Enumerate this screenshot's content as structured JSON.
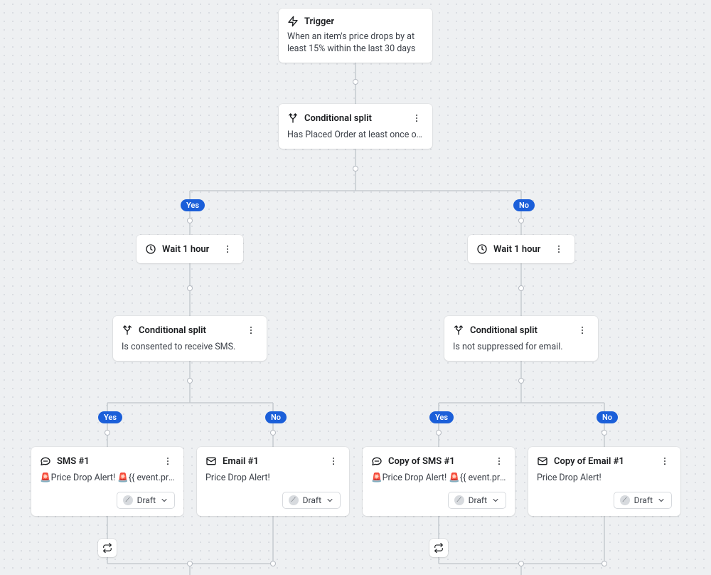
{
  "trigger": {
    "title": "Trigger",
    "body": "When an item's price drops by at least 15% within the last 30 days"
  },
  "split_top": {
    "title": "Conditional split",
    "body": "Has Placed Order at least once over all ti…"
  },
  "labels": {
    "yes": "Yes",
    "no": "No"
  },
  "wait_left": {
    "title": "Wait 1 hour"
  },
  "wait_right": {
    "title": "Wait 1 hour"
  },
  "split_left": {
    "title": "Conditional split",
    "body": "Is consented to receive SMS."
  },
  "split_right": {
    "title": "Conditional split",
    "body": "Is not suppressed for email."
  },
  "action_sms1": {
    "title": "SMS #1",
    "body": "🚨Price Drop Alert! 🚨{{ event.product_n…",
    "status": "Draft"
  },
  "action_email1": {
    "title": "Email #1",
    "body": "Price Drop Alert!",
    "status": "Draft"
  },
  "action_sms1_copy": {
    "title": "Copy of SMS #1",
    "body": "🚨Price Drop Alert! 🚨{{ event.product_n…",
    "status": "Draft"
  },
  "action_email1_copy": {
    "title": "Copy of Email #1",
    "body": "Price Drop Alert!",
    "status": "Draft"
  }
}
